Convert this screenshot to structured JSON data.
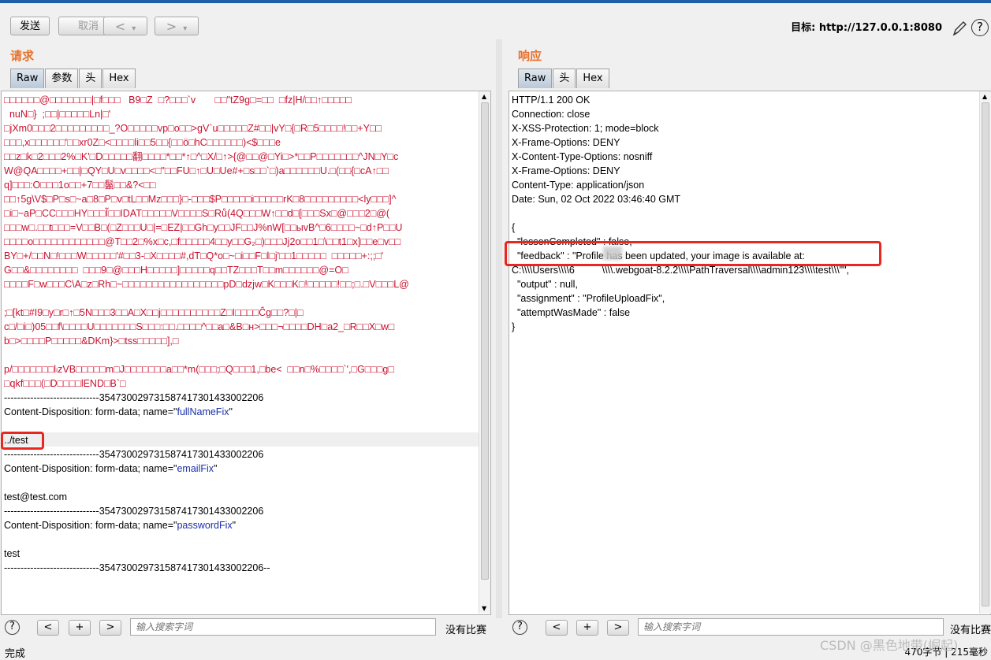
{
  "toolbar": {
    "send_label": "发送",
    "cancel_label": "取消",
    "back_label": "<",
    "back_menu": "▾",
    "forward_label": ">",
    "forward_menu": "▾",
    "target_label": "目标: http://127.0.0.1:8080",
    "help_label": "?"
  },
  "request": {
    "title": "请求",
    "tabs": [
      "Raw",
      "参数",
      "头",
      "Hex"
    ],
    "active_tab": "Raw",
    "lines": [
      "□□□□□□@□□□□□□□|□f□□□   B9□Z  □?□□□`v       □□\"tZ9g□=□□  □fz|H/□□↑□□□□□",
      "  nuN□}  ;□□|□□□□□Ln|□'",
      "□jXm0□□□2□□□□□□□□□_?O□□□□□vp□o□□>gV`u□□□□□Z#□□|vY□{□R□5□□□□!□□+Y□□",
      "□□□,x□□□□□□'□□xr0Z□<□□□□li□□5□□{□□ö□hC□□□□□□)<$□□□e",
      "□□z□k□2□□□2%□K'□D□□□□□翻□□□□*□□*↑□^□X/□↑>{@□□@□Yi□>*□□P□□□□□□□^JN□Y□c",
      "W@QA□□□□+□□|□QY□U□v□□□□<□\"□□FU□↑□U□Ue#+□s□□`□)a□□□□□□U.□(□□{□cA↑□□",
      "q]□□□:O□□□1o□□+7□□鬣□□&?<□□",
      "□□↑5g\\V$□P□s□~a□8□P□v□tL□□Mz□□□}□-□□□$P□□□□□i□□□□□rK□8□□□□□□□□□<ly□□□]^",
      "□i□~aP□CC□□□HY□□□Ĩ□□IDAT□□□□□V□□□□S□Rů(4Q□□□W↑□□d□[□□□Sx□@□□□2□@(",
      "□□□w□.□□t□□□=V□□B□(□Z□□□U□|=□EZ|□□Gh□y□□JF□□J%nW[□□ыvB^□6□□□□~□d↑P□□U",
      "□□□□o□□□□□□□□□□□□@T□□2□%x□c,□f□□□□□4□□y□□G₂□)□□□Jj2o□□1□\\□□t1□x]□□e□v□□",
      "BY□+/□□N□!□□□W□□□□□'#□□3-□X□□□□#,dT□Q*o□~□i□□F□l□j'□□1□□□□□  □□□□□+:;;□'",
      "G□□&□□□□□□□□  □□□9□@□□□H□□□□□]□□□□□q□□TZ□□□T□□m□□□□□□@=O□",
      "□□□□F□w□□□C\\A□z□Rh□~□□□□□□□□□□□□□□□□□pD□dzjw□K□□□K□!□□□□□!□□;□.□V□□□L@",
      "",
      ";□[kt□#I9□y□r□↑□5N□□□3□□A□X□□j□□□□□□□□□□Z□I□□□□Ĉg□□?□|□",
      "c□/□i□)05□□f\\□□□□U□□□□□□□S□□□:□□.□□□□^□□a□&B□н>□□□¬□□□□DH□a2_□R□□X□w□",
      "b□>□□□□P□□□□□&DKm}>□tss□□□□□],□",
      "",
      "p/□□□□□□□lₗzVB□□□□□m□J□□□□□□□a□□*m(□□□;□Q□□□1,□bе<  □□n□%□□□□`',□G□□□g□",
      "□qkf□□□(□D□□□□lEND□B`□",
      "-----------------------------354730029731587417301433002206",
      "Content-Disposition: form-data; name=\"fullNameFix\"",
      "",
      "../test",
      "-----------------------------354730029731587417301433002206",
      "Content-Disposition: form-data; name=\"emailFix\"",
      "",
      "test@test.com",
      "-----------------------------354730029731587417301433002206",
      "Content-Disposition: form-data; name=\"passwordFix\"",
      "",
      "test",
      "-----------------------------354730029731587417301433002206--"
    ]
  },
  "response": {
    "title": "响应",
    "tabs": [
      "Raw",
      "头",
      "Hex"
    ],
    "active_tab": "Raw",
    "lines": [
      "HTTP/1.1 200 OK",
      "Connection: close",
      "X-XSS-Protection: 1; mode=block",
      "X-Frame-Options: DENY",
      "X-Content-Type-Options: nosniff",
      "X-Frame-Options: DENY",
      "Content-Type: application/json",
      "Date: Sun, 02 Oct 2022 03:46:40 GMT",
      "",
      "{",
      "  \"lessonCompleted\" : false,",
      "  \"feedback\" : \"Profile has been updated, your image is available at:",
      "C:\\\\\\\\Users\\\\\\\\6          \\\\\\\\.webgoat-8.2.2\\\\\\\\PathTraversal\\\\\\\\admin123\\\\\\\\test\\\\\\\"\",",
      "  \"output\" : null,",
      "  \"assignment\" : \"ProfileUploadFix\",",
      "  \"attemptWasMade\" : false",
      "}"
    ]
  },
  "search": {
    "placeholder": "输入搜索字词",
    "prev": "<",
    "add": "+",
    "next": ">",
    "no_match": "没有比赛"
  },
  "status": {
    "left": "完成",
    "right": "470字节 | 215毫秒"
  },
  "watermark": "CSDN @黑色地带(崛起)",
  "colors": {
    "title": "#e8702a",
    "binary_text": "#c8102e",
    "param_name": "#1a2fa8",
    "annotation": "#e8281e"
  }
}
